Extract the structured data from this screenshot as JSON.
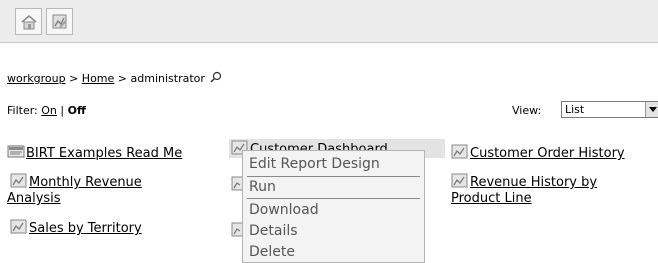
{
  "toolbar": {
    "home_icon": "home-icon",
    "report_icon": "report-design-icon"
  },
  "breadcrumb": {
    "workgroup": "workgroup",
    "sep1": " > ",
    "home": "Home",
    "sep2": " > ",
    "current": "administrator"
  },
  "filter": {
    "label": "Filter: ",
    "on": "On",
    "divider": " | ",
    "off": "Off"
  },
  "view": {
    "label": "View:",
    "selected": "List"
  },
  "items": {
    "readme": "BIRT Examples Read Me",
    "customer_dashboard": "Customer Dashboard",
    "customer_order_history": "Customer Order History",
    "monthly_revenue_line1": "Monthly Revenue",
    "monthly_revenue_line2": "Analysis",
    "revenue_history_line1": "Revenue History by",
    "revenue_history_line2": "Product Line",
    "sales_by_territory": "Sales by Territory"
  },
  "context_menu": {
    "edit": "Edit Report Design",
    "run": "Run",
    "download": "Download",
    "details": "Details",
    "delete": "Delete"
  },
  "colors": {
    "toolbar_bg": "#ececec",
    "menu_bg": "#f3f3f3",
    "menu_text": "#555555",
    "highlight": "#e3e3e3"
  }
}
